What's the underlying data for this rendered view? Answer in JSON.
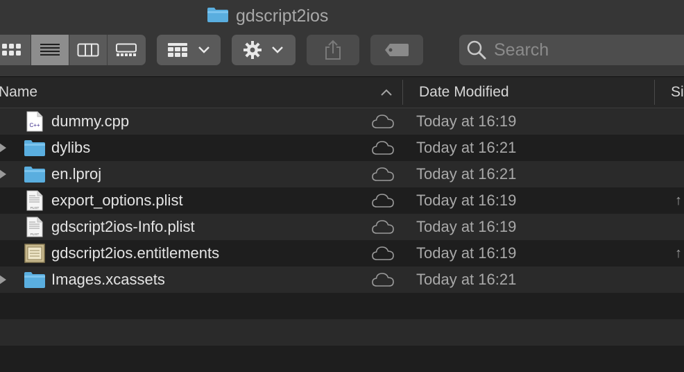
{
  "window": {
    "title": "gdscript2ios",
    "title_icon": "folder-icon"
  },
  "toolbar": {
    "view_buttons": [
      {
        "name": "icon-view",
        "icon": "grid-icon",
        "active": false
      },
      {
        "name": "list-view",
        "icon": "list-icon",
        "active": true
      },
      {
        "name": "column-view",
        "icon": "columns-icon",
        "active": false
      },
      {
        "name": "gallery-view",
        "icon": "gallery-icon",
        "active": false
      }
    ],
    "group_icon": "group-by-icon",
    "action_icon": "gear-icon",
    "share_icon": "share-icon",
    "tag_icon": "tag-icon",
    "search_placeholder": "Search"
  },
  "columns": {
    "name": "Name",
    "date_modified": "Date Modified",
    "size": "Si"
  },
  "files": [
    {
      "name": "dummy.cpp",
      "kind": "cpp-file",
      "expandable": false,
      "date": "Today at 16:19",
      "cloud": true,
      "extra": ""
    },
    {
      "name": "dylibs",
      "kind": "folder",
      "expandable": true,
      "date": "Today at 16:21",
      "cloud": true,
      "extra": ""
    },
    {
      "name": "en.lproj",
      "kind": "folder",
      "expandable": true,
      "date": "Today at 16:21",
      "cloud": true,
      "extra": ""
    },
    {
      "name": "export_options.plist",
      "kind": "plist-file",
      "expandable": false,
      "date": "Today at 16:19",
      "cloud": true,
      "extra": "↑"
    },
    {
      "name": "gdscript2ios-Info.plist",
      "kind": "plist-file",
      "expandable": false,
      "date": "Today at 16:19",
      "cloud": true,
      "extra": ""
    },
    {
      "name": "gdscript2ios.entitlements",
      "kind": "entitlements-file",
      "expandable": false,
      "date": "Today at 16:19",
      "cloud": true,
      "extra": "↑"
    },
    {
      "name": "Images.xcassets",
      "kind": "folder",
      "expandable": true,
      "date": "Today at 16:21",
      "cloud": true,
      "extra": ""
    }
  ],
  "colors": {
    "folder": "#5aaedf",
    "folder_top": "#7cc4ee",
    "background": "#1e1e1e",
    "row_alt": "#2a2a2a"
  },
  "icon_text": {
    "cpp": "C++",
    "plist": "PLIST"
  }
}
